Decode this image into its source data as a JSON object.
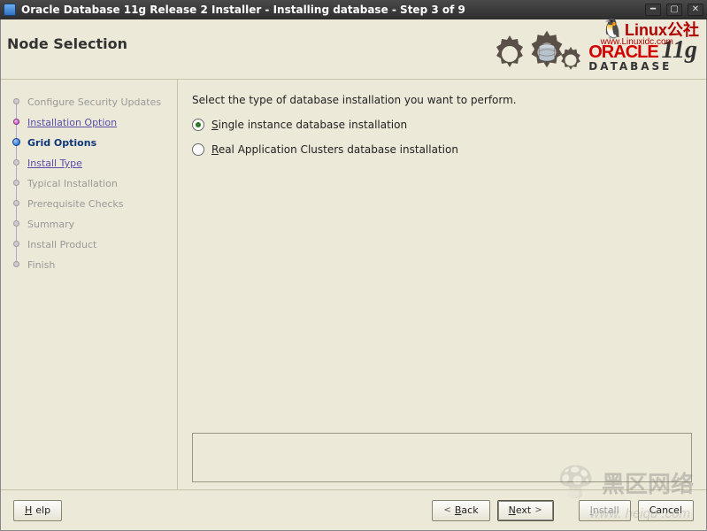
{
  "window": {
    "title": "Oracle Database 11g Release 2 Installer - Installing database - Step 3 of 9"
  },
  "header": {
    "page_title": "Node Selection",
    "brand_oracle": "ORACLE",
    "brand_db": "DATABASE",
    "brand_version": "11g",
    "overlay_site": "Linux公社",
    "overlay_url": "www.Linuxidc.com"
  },
  "sidebar": {
    "items": [
      {
        "label": "Configure Security Updates",
        "state": "inactive"
      },
      {
        "label": "Installation Option",
        "state": "completed"
      },
      {
        "label": "Grid Options",
        "state": "current"
      },
      {
        "label": "Install Type",
        "state": "link"
      },
      {
        "label": "Typical Installation",
        "state": "inactive"
      },
      {
        "label": "Prerequisite Checks",
        "state": "inactive"
      },
      {
        "label": "Summary",
        "state": "inactive"
      },
      {
        "label": "Install Product",
        "state": "inactive"
      },
      {
        "label": "Finish",
        "state": "inactive"
      }
    ]
  },
  "main": {
    "instructions": "Select the type of database installation you want to perform.",
    "options": [
      {
        "label_pre": "",
        "mn": "S",
        "label_post": "ingle instance database installation",
        "selected": true
      },
      {
        "label_pre": "",
        "mn": "R",
        "label_post": "eal Application Clusters database installation",
        "selected": false
      }
    ]
  },
  "footer": {
    "help_mn": "H",
    "help_post": "elp",
    "back_mn": "B",
    "back_post": "ack",
    "next_mn": "N",
    "next_post": "ext",
    "install_mn": "I",
    "install_post": "nstall",
    "cancel": "Cancel"
  },
  "watermark": {
    "line1": "黑区网络",
    "line2": "www. heiqu .com"
  }
}
